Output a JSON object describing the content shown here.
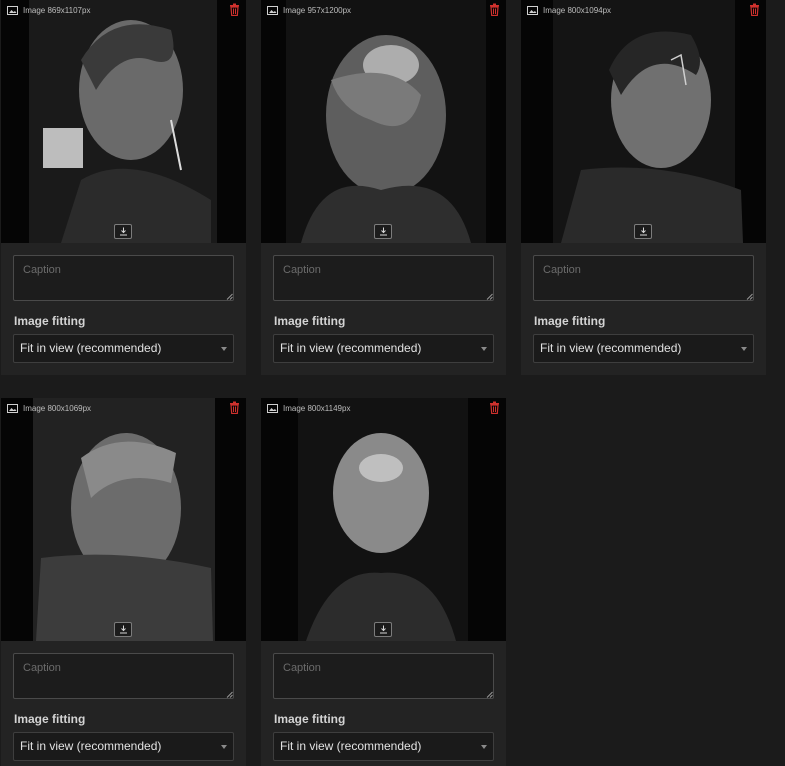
{
  "cards": [
    {
      "dims_label": "Image 869x1107px",
      "caption_placeholder": "Caption",
      "fitting_label": "Image fitting",
      "fitting_value": "Fit in view (recommended)"
    },
    {
      "dims_label": "Image 957x1200px",
      "caption_placeholder": "Caption",
      "fitting_label": "Image fitting",
      "fitting_value": "Fit in view (recommended)"
    },
    {
      "dims_label": "Image 800x1094px",
      "caption_placeholder": "Caption",
      "fitting_label": "Image fitting",
      "fitting_value": "Fit in view (recommended)"
    },
    {
      "dims_label": "Image 800x1069px",
      "caption_placeholder": "Caption",
      "fitting_label": "Image fitting",
      "fitting_value": "Fit in view (recommended)"
    },
    {
      "dims_label": "Image 800x1149px",
      "caption_placeholder": "Caption",
      "fitting_label": "Image fitting",
      "fitting_value": "Fit in view (recommended)"
    }
  ],
  "icons": {
    "header": "image-icon",
    "delete": "trash-icon",
    "download": "download-icon",
    "dropdown": "chevron-down-icon"
  },
  "colors": {
    "background": "#1b1b1b",
    "card": "#232323",
    "delete": "#d0312d"
  }
}
